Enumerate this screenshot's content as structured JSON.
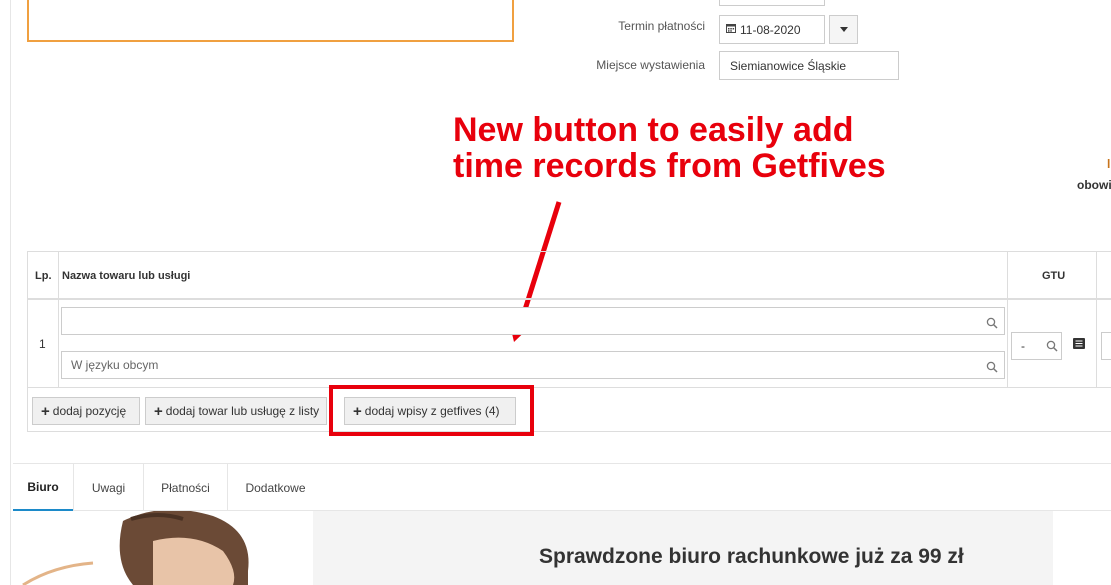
{
  "invoice_form": {
    "payment_due_label": "Termin płatności",
    "payment_due_value": "11-08-2020",
    "issue_place_label": "Miejsce wystawienia",
    "issue_place_value": "Siemianowice  Śląskie"
  },
  "annotation": {
    "line1": "New button to easily add",
    "line2": "time records from Getfives",
    "color": "#e8000c"
  },
  "right_cut": {
    "text1": "l",
    "text2": "obowi"
  },
  "items_table": {
    "col_lp": "Lp.",
    "col_name": "Nazwa towaru lub usługi",
    "col_gtu": "GTU",
    "rows": [
      {
        "lp": "1",
        "name_value": "",
        "foreign_placeholder": "W języku obcym",
        "gtu_value": "-"
      }
    ]
  },
  "actions": {
    "add_position": "dodaj pozycję",
    "add_from_list": "dodaj towar lub usługę z listy",
    "add_getfives": "dodaj wpisy z getfives (4)"
  },
  "tabs": [
    {
      "label": "Biuro",
      "active": true
    },
    {
      "label": "Uwagi",
      "active": false
    },
    {
      "label": "Płatności",
      "active": false
    },
    {
      "label": "Dodatkowe",
      "active": false
    }
  ],
  "promo": {
    "title": "Sprawdzone biuro rachunkowe już za 99 zł"
  },
  "colors": {
    "accent_tab": "#1c8ac9",
    "panel_border": "#f0a040",
    "annotation_red": "#e8000c"
  }
}
